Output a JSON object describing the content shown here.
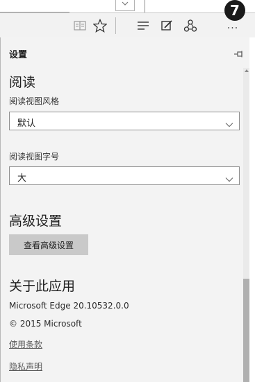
{
  "toolbar": {
    "icons": [
      "reading-view-icon",
      "favorite-star-icon",
      "hub-icon",
      "web-note-icon",
      "share-icon",
      "more-icon"
    ],
    "more_label": "···",
    "badge": "7"
  },
  "panel": {
    "title": "设置",
    "reading": {
      "title": "阅读",
      "style_label": "阅读视图风格",
      "style_value": "默认",
      "font_label": "阅读视图字号",
      "font_value": "大"
    },
    "advanced": {
      "title": "高级设置",
      "button": "查看高级设置"
    },
    "about": {
      "title": "关于此应用",
      "version": "Microsoft Edge 20.10532.0.0",
      "copyright": "© 2015 Microsoft",
      "terms_link": "使用条款",
      "privacy_link": "隐私声明"
    }
  },
  "colors": {
    "panel_bg": "#f3f3f3",
    "toolbar_bg": "#f2f2f2",
    "button_bg": "#c9c9c9",
    "scroll_thumb": "#b0b0b0"
  }
}
